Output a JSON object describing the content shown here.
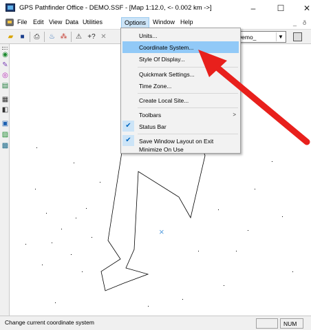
{
  "window": {
    "title": "GPS Pathfinder Office - DEMO.SSF - [Map 1:12.0, <- 0.002 km ->]",
    "minimize_glyph": "–",
    "maximize_glyph": "☐",
    "close_glyph": "✕"
  },
  "menubar": {
    "items": [
      "File",
      "Edit",
      "View",
      "Data",
      "Utilities",
      "Options",
      "Window",
      "Help"
    ],
    "active": "Options",
    "mdi_minimize": "_",
    "mdi_restore": "ð"
  },
  "toolbar": {
    "icons": [
      "open-icon",
      "save-icon",
      "print-icon",
      "data-icon",
      "grid-icon",
      "measure-icon",
      "help-icon",
      "cross-icon"
    ],
    "help_text": "+?",
    "combo_value": "Demo_",
    "combo_arrow": "▼"
  },
  "left_toolbar": {
    "icons": [
      "globe-icon",
      "pen-icon",
      "target-icon",
      "layers-icon",
      "table-icon",
      "export-icon",
      "grid-tool-icon",
      "layer-edit-icon",
      "map-icon"
    ]
  },
  "options_menu": {
    "items": [
      {
        "label": "Units...",
        "checked": false,
        "highlight": false,
        "submenu": false
      },
      {
        "label": "Coordinate System...",
        "checked": false,
        "highlight": true,
        "submenu": false
      },
      {
        "label": "Style Of Display...",
        "checked": false,
        "highlight": false,
        "submenu": false
      },
      {
        "label": "Quickmark Settings...",
        "checked": false,
        "highlight": false,
        "submenu": false
      },
      {
        "label": "Time Zone...",
        "checked": false,
        "highlight": false,
        "submenu": false
      },
      {
        "label": "Create Local Site...",
        "checked": false,
        "highlight": false,
        "submenu": false
      },
      {
        "label": "Toolbars",
        "checked": false,
        "highlight": false,
        "submenu": true
      },
      {
        "label": "Status Bar",
        "checked": true,
        "highlight": false,
        "submenu": false
      },
      {
        "label": "Save Window Layout on Exit",
        "checked": true,
        "highlight": false,
        "submenu": false
      },
      {
        "label": "Minimize On Use",
        "checked": false,
        "highlight": false,
        "submenu": false
      }
    ],
    "check_glyph": "✔",
    "submenu_glyph": ">"
  },
  "map": {
    "track_color": "#000000",
    "marker_color": "#5aa0e0",
    "marker_glyph": "×"
  },
  "annotation": {
    "arrow_color": "#e8201c"
  },
  "statusbar": {
    "text": "Change current coordinate system",
    "num_label": "NUM"
  }
}
